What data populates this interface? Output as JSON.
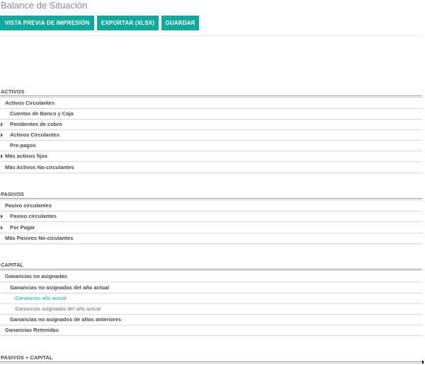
{
  "page": {
    "title": "Balance de Situación"
  },
  "toolbar": {
    "print_preview": "VISTA PREVIA DE IMPRESIÓN",
    "export_xlsx": "EXPORTAR (XLSX)",
    "save": "GUARDAR"
  },
  "activos": {
    "title": "ACTIVOS",
    "rows": [
      {
        "label": "Activos Circulantes",
        "expandable": false
      },
      {
        "label": "Cuentas de Banco y Caja",
        "expandable": false
      },
      {
        "label": "Pendientes de cobro",
        "expandable": true
      },
      {
        "label": "Activos Circulantes",
        "expandable": true
      },
      {
        "label": "Pre-pagos",
        "expandable": false
      },
      {
        "label": "Más activos fijos",
        "expandable": true
      },
      {
        "label": "Más Activos No-circulantes",
        "expandable": false
      }
    ]
  },
  "pasivos": {
    "title": "PASIVOS",
    "rows": [
      {
        "label": "Pasivo circulantes",
        "expandable": false
      },
      {
        "label": "Pasivo circulantes",
        "expandable": true
      },
      {
        "label": "Por Pagar",
        "expandable": true
      },
      {
        "label": "Más Pasivos No-ciculantes",
        "expandable": false
      }
    ]
  },
  "capital": {
    "title": "CAPITAL",
    "rows": [
      {
        "label": "Ganancias no asignadas"
      },
      {
        "label": "Ganancias no asignadas del año actual"
      },
      {
        "label": "Ganancias año actual"
      },
      {
        "label": "Ganancias asignadas del año actual"
      },
      {
        "label": "Ganancias no asignados de años anteriores"
      },
      {
        "label": "Ganancias Retenidas"
      }
    ]
  },
  "total": {
    "title": "PASIVOS + CAPITAL"
  },
  "colors": {
    "accent": "#13a89e"
  }
}
